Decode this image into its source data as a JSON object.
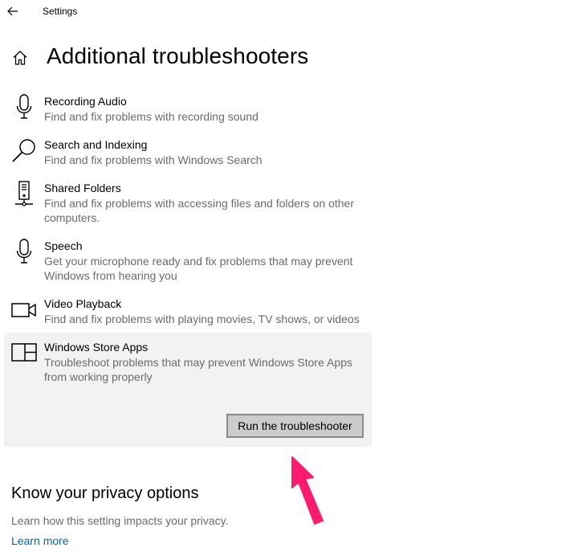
{
  "window": {
    "title": "Settings",
    "back_icon": "back-arrow-icon"
  },
  "header": {
    "home_icon": "home-icon",
    "title": "Additional troubleshooters"
  },
  "troubleshooters": [
    {
      "name": "Recording Audio",
      "description": "Find and fix problems with recording sound",
      "icon": "microphone-icon"
    },
    {
      "name": "Search and Indexing",
      "description": "Find and fix problems with Windows Search",
      "icon": "search-icon"
    },
    {
      "name": "Shared Folders",
      "description": "Find and fix problems with accessing files and folders on other computers.",
      "icon": "network-folder-icon"
    },
    {
      "name": "Speech",
      "description": "Get your microphone ready and fix problems that may prevent Windows from hearing you",
      "icon": "microphone-icon"
    },
    {
      "name": "Video Playback",
      "description": "Find and fix problems with playing movies, TV shows, or videos",
      "icon": "video-camera-icon"
    },
    {
      "name": "Windows Store Apps",
      "description": "Troubleshoot problems that may prevent Windows Store Apps from working properly",
      "icon": "store-apps-icon",
      "selected": true
    }
  ],
  "run_button_label": "Run the troubleshooter",
  "privacy": {
    "title": "Know your privacy options",
    "description": "Learn how this setting impacts your privacy.",
    "link": "Learn more"
  },
  "colors": {
    "accent_link": "#0067b8",
    "selected_bg": "#f2f2f2",
    "secondary_text": "#6b6b6b",
    "annotation_arrow": "#ff1a6e"
  }
}
